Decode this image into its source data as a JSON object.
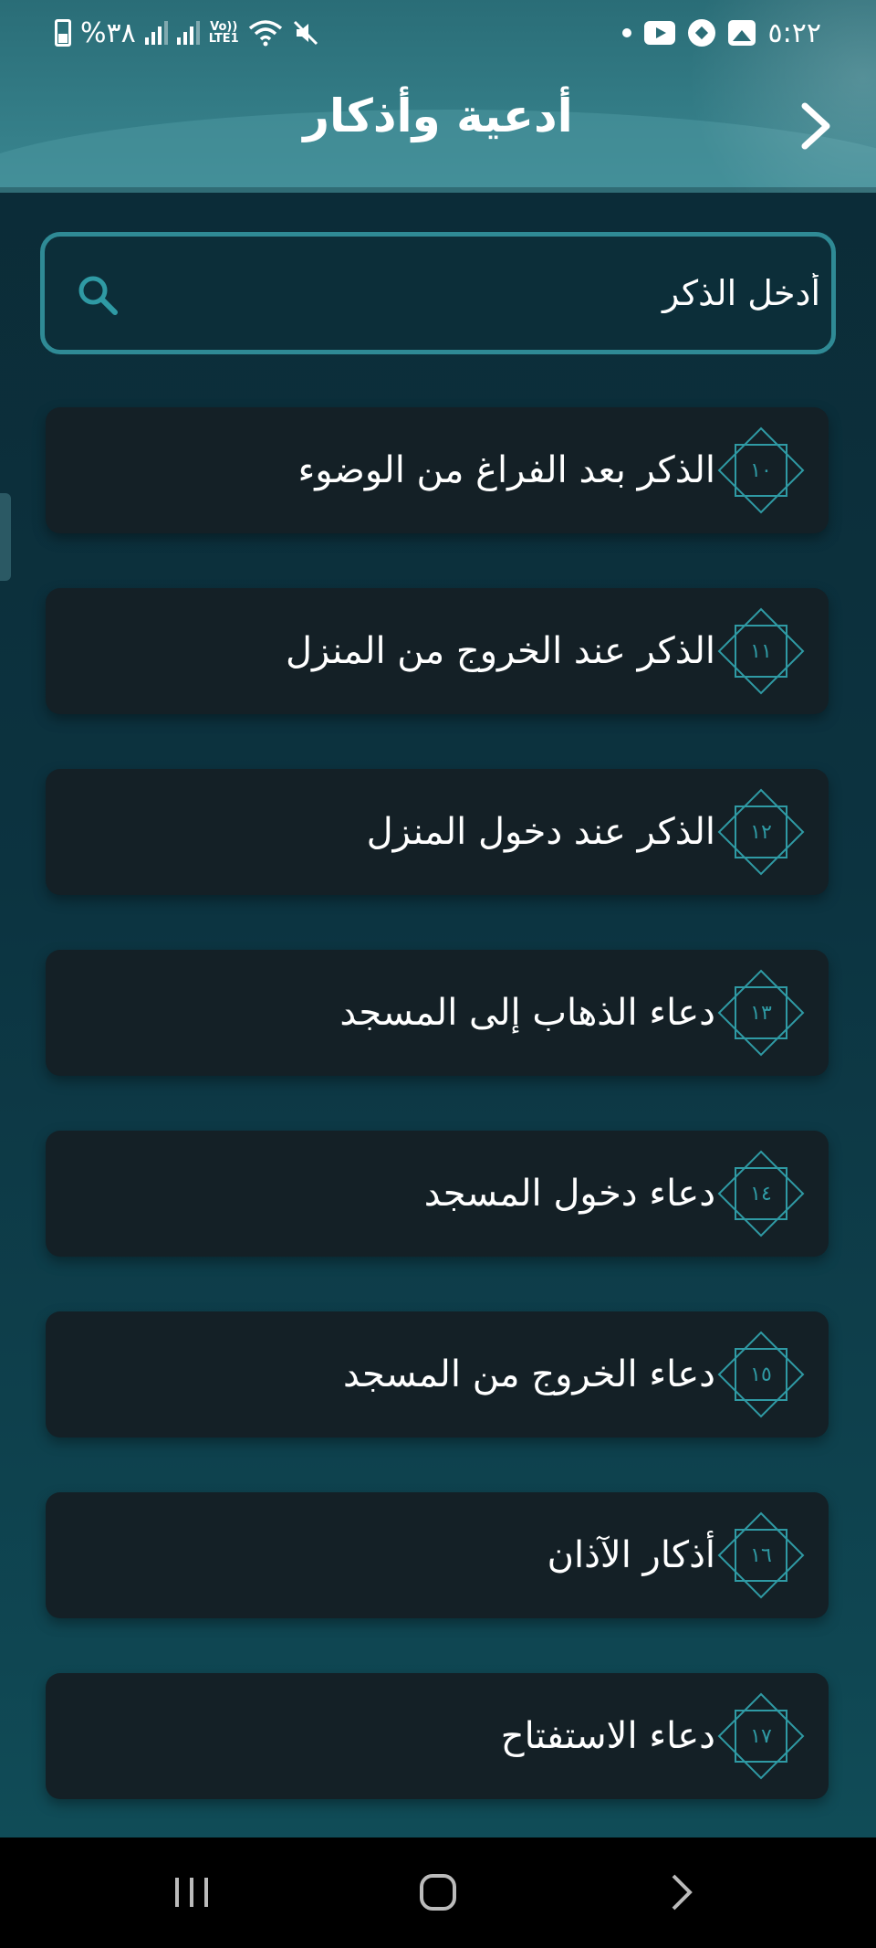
{
  "status_bar": {
    "battery_percent": "%٣٨",
    "network": "LTE1",
    "volte": "Vo))",
    "time": "٥:٢٢"
  },
  "header": {
    "title": "أدعية وأذكار",
    "back_icon": "chevron-right-icon"
  },
  "search": {
    "placeholder": "أدخل الذكر",
    "icon": "search-icon"
  },
  "items": [
    {
      "number": "١٠",
      "label": "الذكر بعد الفراغ من الوضوء"
    },
    {
      "number": "١١",
      "label": "الذكر عند الخروج من المنزل"
    },
    {
      "number": "١٢",
      "label": "الذكر عند دخول المنزل"
    },
    {
      "number": "١٣",
      "label": "دعاء الذهاب إلى المسجد"
    },
    {
      "number": "١٤",
      "label": "دعاء دخول المسجد"
    },
    {
      "number": "١٥",
      "label": "دعاء الخروج من المسجد"
    },
    {
      "number": "١٦",
      "label": "أذكار الآذان"
    },
    {
      "number": "١٧",
      "label": "دعاء الاستفتاح"
    }
  ],
  "colors": {
    "accent": "#2f9aa4",
    "card": "#142026",
    "header": "#3a8791"
  }
}
